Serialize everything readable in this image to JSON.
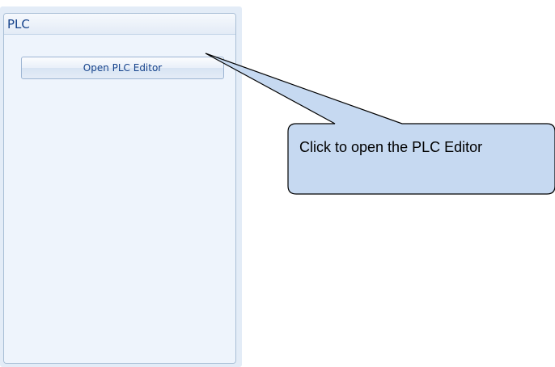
{
  "panel": {
    "title": "PLC",
    "open_editor_button_label": "Open PLC Editor"
  },
  "callout": {
    "text": "Click to open the PLC Editor",
    "fill_color": "#c6d9f1",
    "stroke_color": "#000000"
  }
}
